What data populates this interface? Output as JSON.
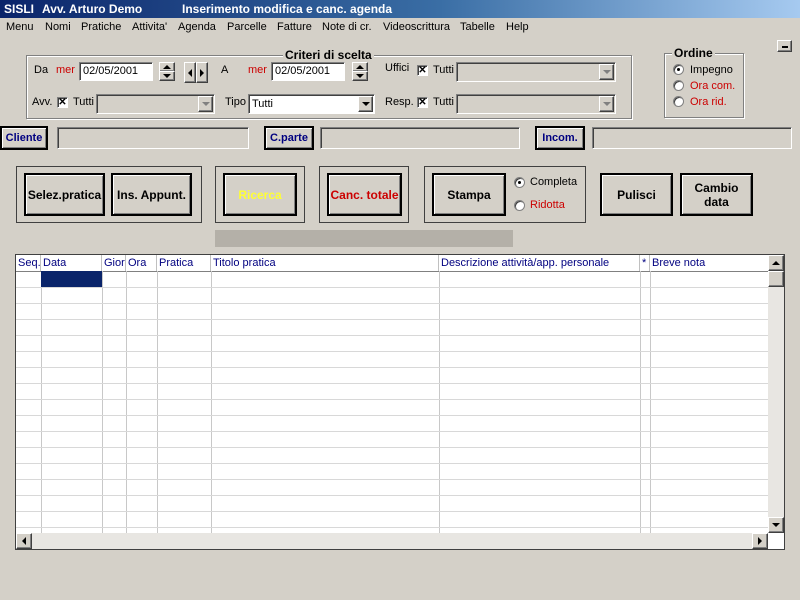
{
  "titlebar": {
    "app": "SISLI",
    "user": "Avv.  Arturo Demo",
    "window": "Inserimento modifica e canc. agenda"
  },
  "menu": [
    "Menu",
    "Nomi",
    "Pratiche",
    "Attivita'",
    "Agenda",
    "Parcelle",
    "Fatture",
    "Note di cr.",
    "Videoscrittura",
    "Tabelle",
    "Help"
  ],
  "criteri": {
    "title": "Criteri di scelta",
    "da_label": "Da",
    "da_day": "mer",
    "da_date": "02/05/2001",
    "a_label": "A",
    "a_day": "mer",
    "a_date": "02/05/2001",
    "uffici_label": "Uffici",
    "uffici_tutti": "Tutti",
    "uffici_value": "",
    "avv_label": "Avv.",
    "avv_tutti": "Tutti",
    "avv_value": "",
    "tipo_label": "Tipo",
    "tipo_value": "Tutti",
    "resp_label": "Resp.",
    "resp_tutti": "Tutti",
    "resp_value": ""
  },
  "ordine": {
    "title": "Ordine",
    "options": [
      "Impegno",
      "Ora com.",
      "Ora rid."
    ],
    "selected": "Impegno"
  },
  "fields": {
    "cliente": "Cliente",
    "cliente_value": "",
    "cparte": "C.parte",
    "cparte_value": "",
    "incom": "Incom.",
    "incom_value": ""
  },
  "buttons": {
    "selez": "Selez.pratica",
    "ins": "Ins. Appunt.",
    "ricerca": "Ricerca",
    "canc": "Canc. totale",
    "stampa": "Stampa",
    "completa": "Completa",
    "ridotta": "Ridotta",
    "pulisci": "Pulisci",
    "cambio": "Cambio data"
  },
  "grid": {
    "columns": [
      "Seq.",
      "Data",
      "Giorn",
      "Ora",
      "Pratica",
      "Titolo pratica",
      "Descrizione attività/app. personale",
      "*",
      "Breve nota"
    ],
    "rows": []
  },
  "colors": {
    "ricerca": "#ffff33",
    "canc": "#cc0000",
    "accent_red": "#cc0000",
    "label_navy": "#000080",
    "selection": "#0a246a"
  }
}
